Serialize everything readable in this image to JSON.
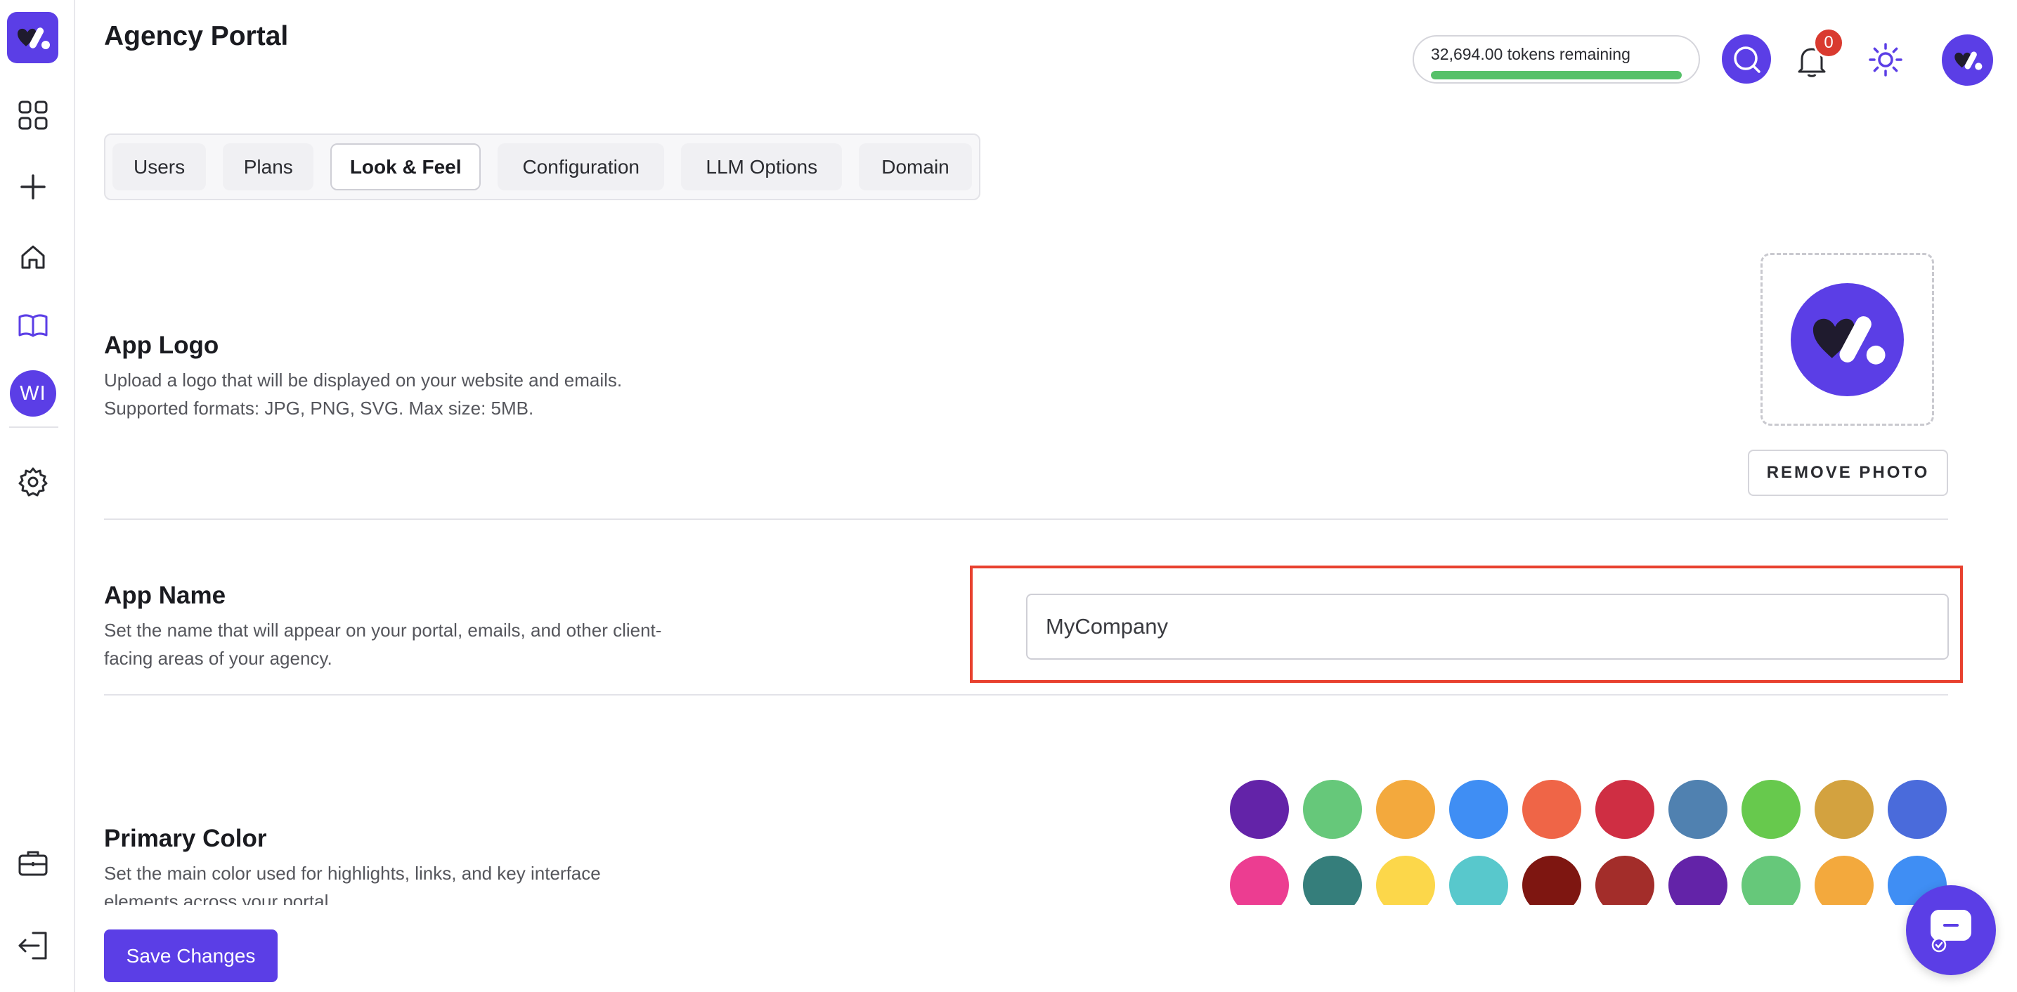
{
  "header": {
    "title": "Agency Portal",
    "tokens_text": "32,694.00 tokens remaining",
    "tokens_fraction": 1.0,
    "notification_count": "0"
  },
  "sidebar": {
    "avatar_initials": "WI",
    "items": [
      {
        "icon": "grid-icon"
      },
      {
        "icon": "plus-icon"
      },
      {
        "icon": "home-icon"
      },
      {
        "icon": "book-icon",
        "active": true
      },
      {
        "icon": "gear-icon"
      },
      {
        "icon": "briefcase-icon"
      },
      {
        "icon": "logout-icon"
      }
    ]
  },
  "tabs": [
    {
      "label": "Users"
    },
    {
      "label": "Plans"
    },
    {
      "label": "Look & Feel",
      "active": true
    },
    {
      "label": "Configuration"
    },
    {
      "label": "LLM Options"
    },
    {
      "label": "Domain"
    }
  ],
  "app_logo": {
    "title": "App Logo",
    "desc_line1": "Upload a logo that will be displayed on your website and emails.",
    "desc_line2": "Supported formats: JPG, PNG, SVG. Max size: 5MB.",
    "remove_label": "REMOVE PHOTO"
  },
  "app_name": {
    "title": "App Name",
    "desc_line1": "Set the name that will appear on your portal, emails, and other client-",
    "desc_line2": "facing areas of your agency.",
    "value": "MyCompany"
  },
  "primary_color": {
    "title": "Primary Color",
    "desc_line1": "Set the main color used for highlights, links, and key interface",
    "desc_line2": "elements across your portal.",
    "swatches": [
      "#6323a8",
      "#66c87a",
      "#f3a93d",
      "#3f8ef4",
      "#ef6547",
      "#cf2e43",
      "#5081b0",
      "#67c94d",
      "#d3a23f",
      "#4a6bdb",
      "#ec3d91",
      "#357e7b",
      "#fcd74a",
      "#58c8cc",
      "#7e1611",
      "#a32d2a",
      "#6323a8",
      "#66c87a",
      "#f3a93d",
      "#3f8ef4"
    ]
  },
  "actions": {
    "save_label": "Save Changes"
  },
  "colors": {
    "brand": "#5b3ee6",
    "highlight": "#e8412f",
    "token_bar": "#56c169",
    "badge": "#d93a2f"
  }
}
